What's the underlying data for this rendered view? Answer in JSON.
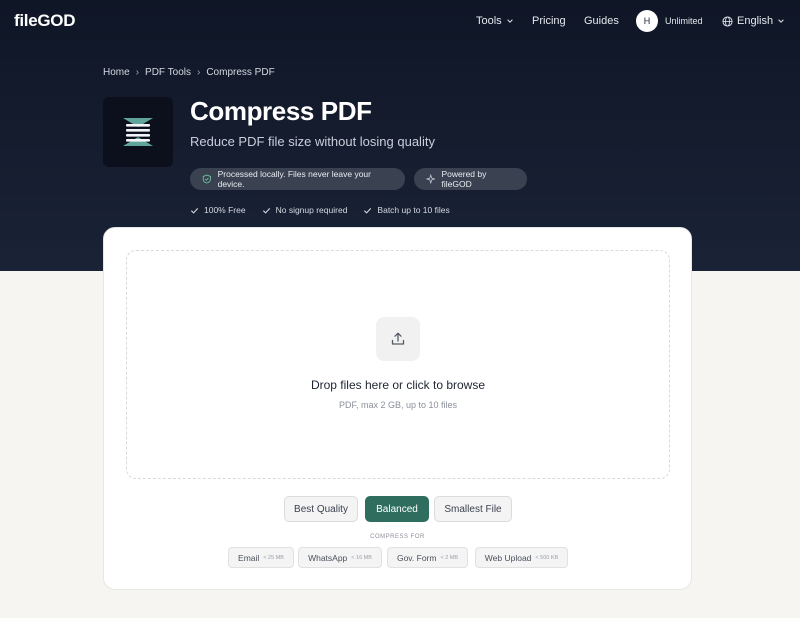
{
  "brand": {
    "logo": "fileGOD"
  },
  "nav": {
    "tools": "Tools",
    "pricing": "Pricing",
    "guides": "Guides",
    "avatar_initial": "H",
    "plan": "Unlimited",
    "language": "English"
  },
  "breadcrumb": [
    "Home",
    "PDF Tools",
    "Compress PDF"
  ],
  "hero": {
    "title": "Compress PDF",
    "subtitle": "Reduce PDF file size without losing quality",
    "privacy_pill": "Processed locally. Files never leave your device.",
    "powered_pill": "Powered by fileGOD",
    "features": [
      "100% Free",
      "No signup required",
      "Batch up to 10 files"
    ]
  },
  "dropzone": {
    "title": "Drop files here or click to browse",
    "subtitle": "PDF, max 2 GB, up to 10 files"
  },
  "quality": {
    "options": [
      "Best Quality",
      "Balanced",
      "Smallest File"
    ],
    "selected": "Balanced"
  },
  "compress_for": {
    "label": "COMPRESS FOR",
    "presets": [
      {
        "name": "Email",
        "limit": "< 25 MB"
      },
      {
        "name": "WhatsApp",
        "limit": "< 16 MB"
      },
      {
        "name": "Gov. Form",
        "limit": "< 2 MB"
      },
      {
        "name": "Web Upload",
        "limit": "< 500 KB"
      }
    ]
  },
  "colors": {
    "hero_bg": "#141b2c",
    "accent": "#2f6e5e",
    "page_bg": "#f6f5f1"
  }
}
